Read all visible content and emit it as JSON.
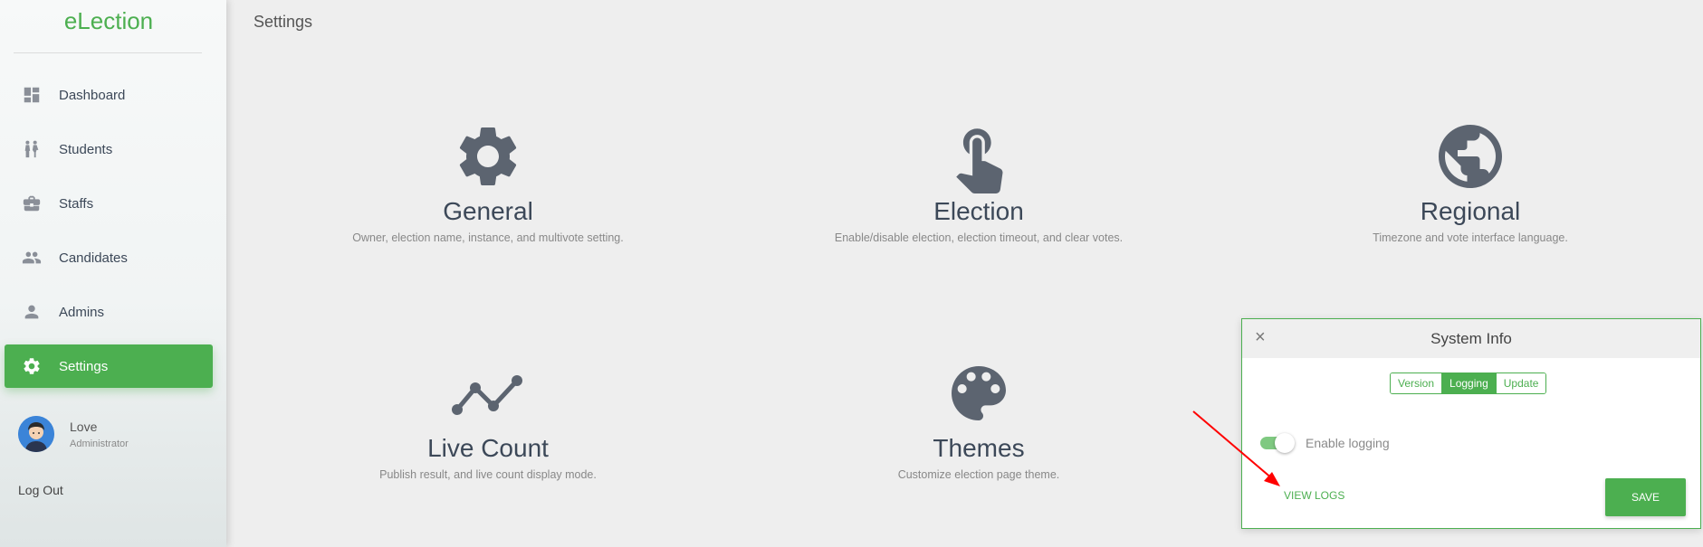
{
  "brand": "eLection",
  "sidebar": {
    "items": [
      {
        "label": "Dashboard",
        "icon": "dashboard-icon"
      },
      {
        "label": "Students",
        "icon": "students-icon"
      },
      {
        "label": "Staffs",
        "icon": "briefcase-icon"
      },
      {
        "label": "Candidates",
        "icon": "people-icon"
      },
      {
        "label": "Admins",
        "icon": "person-icon"
      },
      {
        "label": "Settings",
        "icon": "gear-icon",
        "active": true
      }
    ],
    "user": {
      "name": "Love",
      "role": "Administrator"
    },
    "logout": "Log Out"
  },
  "header": {
    "title": "Settings"
  },
  "cards": [
    {
      "title": "General",
      "desc": "Owner, election name, instance, and multivote setting.",
      "icon": "gear-icon"
    },
    {
      "title": "Election",
      "desc": "Enable/disable election, election timeout, and clear votes.",
      "icon": "touch-icon"
    },
    {
      "title": "Regional",
      "desc": "Timezone and vote interface language.",
      "icon": "globe-icon"
    },
    {
      "title": "Live Count",
      "desc": "Publish result, and live count display mode.",
      "icon": "trend-line-icon"
    },
    {
      "title": "Themes",
      "desc": "Customize election page theme.",
      "icon": "palette-icon"
    }
  ],
  "dialog": {
    "title": "System Info",
    "close": "×",
    "tabs": [
      "Version",
      "Logging",
      "Update"
    ],
    "active_tab": "Logging",
    "toggle_label": "Enable logging",
    "toggle_on": true,
    "view_logs": "VIEW LOGS",
    "save": "SAVE"
  },
  "colors": {
    "accent": "#4caf50",
    "annotation": "#ff0000"
  }
}
